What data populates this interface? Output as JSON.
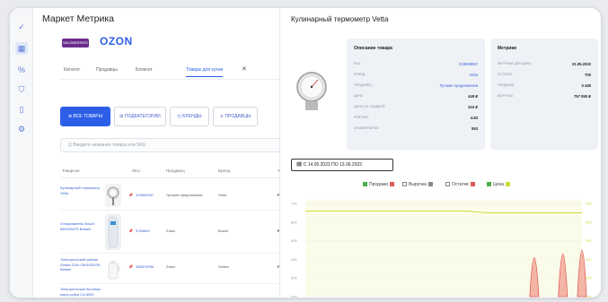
{
  "app": {
    "title": "Маркет Метрика"
  },
  "rail": {
    "items": [
      "check-icon",
      "grid-icon",
      "percent-icon",
      "shield-icon",
      "document-icon",
      "settings-icon"
    ]
  },
  "marketplace": {
    "badge": "WILDBERRIES",
    "logo": "OZON"
  },
  "nav": {
    "tabs": [
      "Каталог",
      "Продавцы",
      "Блокнот",
      "Товары для кухни"
    ],
    "close": "✕"
  },
  "filters": {
    "buttons": [
      "⊕ ВСЕ ТОВАРЫ",
      "⊞ ПОДКАТЕГОРИИ",
      "◷ БРЕНДЫ",
      "♙ ПРОДАВЦЫ"
    ]
  },
  "search": {
    "placeholder": "Q  Введите название товара или SKU"
  },
  "table": {
    "headers": [
      "Товарное",
      "SKU",
      "Продавец",
      "Бренд",
      "Тип"
    ],
    "rows": [
      {
        "name": "Кулинарный термометр Vetta",
        "sku": "319849067",
        "seller": "Лучшие предложения",
        "brand": "Vetta",
        "type": "FBO"
      },
      {
        "name": "Отпариватель Bosch BKR99VPS Betseil",
        "sku": "3784693",
        "seller": "Zolan",
        "brand": "Bosch",
        "type": "Retail"
      },
      {
        "name": "Электрический чайник Smeta ZGN-ONSGW-Rb-Betseil",
        "sku": "366574996",
        "seller": "Zolan",
        "brand": "Smeta",
        "type": "FBO"
      },
      {
        "name": "Электрическая бытовая мясо-рубка CA 8000",
        "sku": "",
        "seller": "",
        "brand": "",
        "type": ""
      }
    ]
  },
  "detail": {
    "title": "Кулинарный термометр Vetta",
    "description": {
      "heading": "Описание товара",
      "fields": [
        {
          "key": "SKU",
          "value": "319849067"
        },
        {
          "key": "Бренд",
          "value": "Vetta"
        },
        {
          "key": "Продавец",
          "value": "Лучшие предложения"
        },
        {
          "key": "Цена",
          "value": "449 ₽"
        },
        {
          "key": "Цена со скидкой",
          "value": "310 ₽"
        },
        {
          "key": "Рейтинг",
          "value": "4.83"
        },
        {
          "key": "Комментарии",
          "value": "553"
        }
      ]
    },
    "metrics": {
      "heading": "Метрики",
      "fields": [
        {
          "key": "Метрики для цены",
          "value": "31.05.2022"
        },
        {
          "key": "Остаток",
          "value": "700"
        },
        {
          "key": "Продажи",
          "value": "3 445"
        },
        {
          "key": "Выручка",
          "value": "757 950 ₽"
        }
      ]
    },
    "date_range": "🗓 С 14.05.2022 ПО 13.06.2022",
    "legend": [
      {
        "label": "Продажи",
        "color": "#e05a5a"
      },
      {
        "label": "Выручка",
        "color": "#8a8a8a"
      },
      {
        "label": "Остатки",
        "color": "#e05a5a"
      },
      {
        "label": "Цена",
        "color": "#cddc39"
      }
    ]
  },
  "chart_data": {
    "type": "line",
    "x_count": 30,
    "y_ticks_left": [
      "700",
      "600",
      "500",
      "400",
      "300",
      "200"
    ],
    "y_ticks_right": [
      "700",
      "600",
      "500",
      "400",
      "300",
      "200"
    ],
    "series": [
      {
        "name": "Остатки",
        "values": [
          660,
          660,
          660,
          660,
          660,
          660,
          660,
          660,
          660,
          660,
          660,
          660,
          660,
          660,
          660,
          660,
          660,
          660,
          655,
          650,
          650,
          650,
          650,
          650,
          650,
          650,
          650,
          650,
          650,
          650
        ]
      },
      {
        "name": "Продажи",
        "values": [
          0,
          0,
          0,
          0,
          0,
          0,
          0,
          0,
          0,
          0,
          0,
          0,
          0,
          0,
          0,
          0,
          0,
          0,
          0,
          0,
          0,
          0,
          0,
          0,
          580,
          0,
          0,
          620,
          0,
          660
        ]
      }
    ]
  }
}
